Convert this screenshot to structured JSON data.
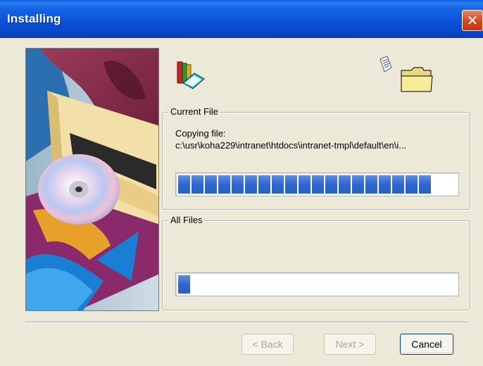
{
  "window": {
    "title": "Installing",
    "close_glyph": "✕"
  },
  "icons": {
    "books": "books-icon",
    "document": "document-icon",
    "folder": "folder-icon"
  },
  "current_file": {
    "legend": "Current File",
    "status_label": "Copying file:",
    "path": "c:\\usr\\koha229\\intranet\\htdocs\\intranet-tmpl\\default\\en\\i...",
    "progress_blocks": 19
  },
  "all_files": {
    "legend": "All Files",
    "progress_blocks": 1
  },
  "buttons": {
    "back": "< Back",
    "next": "Next >",
    "cancel": "Cancel"
  },
  "colors": {
    "titlebar": "#0a50d6",
    "progress_fill": "#2f67cf",
    "dialog_bg": "#ece9d8"
  }
}
